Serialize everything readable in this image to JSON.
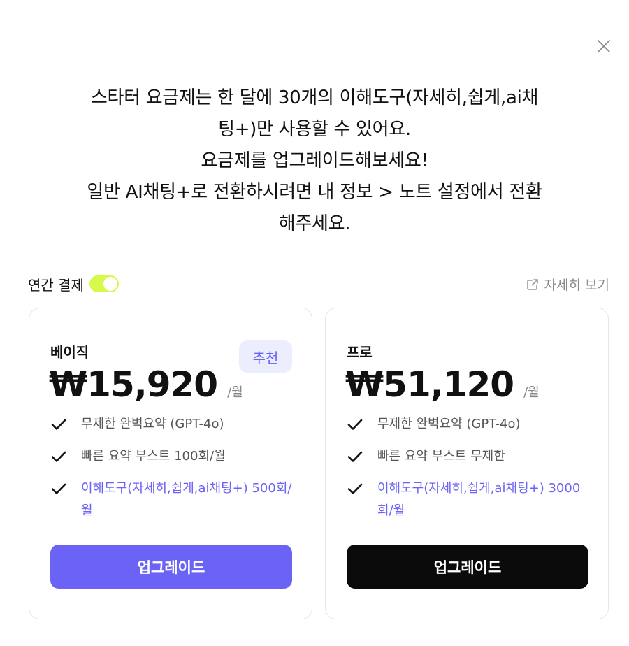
{
  "notice_lines": [
    "스타터 요금제는 한 달에 30개의 이해도구(자세히,쉽게,ai채",
    "팅+)만 사용할 수 있어요.",
    "요금제를 업그레이드해보세요!",
    "일반 AI채팅+로 전환하시려면 내 정보 > 노트 설정에서 전환",
    "해주세요."
  ],
  "billing": {
    "label": "연간 결제",
    "annual_enabled": true,
    "toggle_color": "#d6f94a"
  },
  "detail_link": {
    "label": "자세히 보기",
    "icon": "external-link-icon"
  },
  "icons": {
    "close": "close-icon",
    "check": "check-icon"
  },
  "colors": {
    "accent": "#6a63f6",
    "badge_bg": "#ecedfd",
    "pro_button": "#0b0b0b"
  },
  "plans": [
    {
      "name": "베이직",
      "badge": "추천",
      "price": "₩15,920",
      "unit": "/월",
      "features": [
        {
          "text": "무제한 완벽요약 (GPT-4o)",
          "accent": false
        },
        {
          "text": "빠른 요약 부스트 100회/월",
          "accent": false
        },
        {
          "text": "이해도구(자세히,쉽게,ai채팅+) 500회/월",
          "accent": true
        }
      ],
      "button": "업그레이드"
    },
    {
      "name": "프로",
      "price": "₩51,120",
      "unit": "/월",
      "features": [
        {
          "text": "무제한 완벽요약 (GPT-4o)",
          "accent": false
        },
        {
          "text": "빠른 요약 부스트 무제한",
          "accent": false
        },
        {
          "text": "이해도구(자세히,쉽게,ai채팅+) 3000회/월",
          "accent": true
        }
      ],
      "button": "업그레이드"
    }
  ]
}
